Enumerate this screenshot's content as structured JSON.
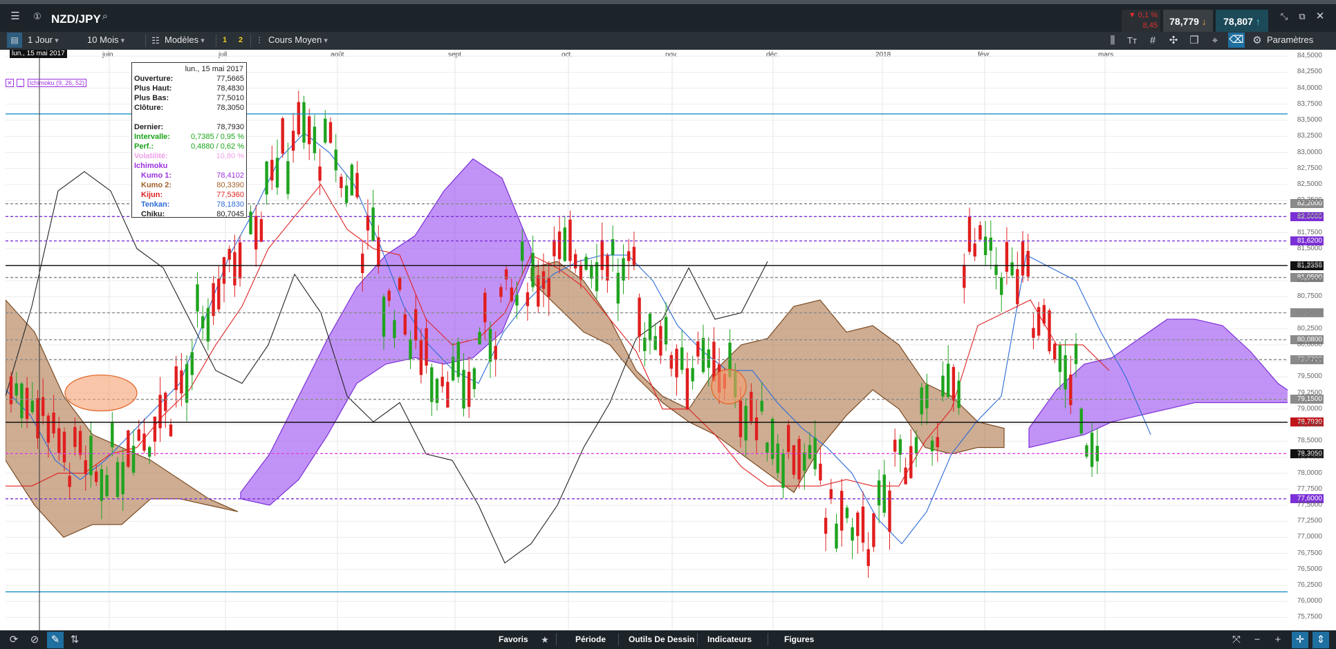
{
  "app": {
    "symbol": "NZD/JPY",
    "change_pct": "▼ 0,1 %",
    "change_abs": "8,45",
    "bid": "78,779",
    "ask": "78,807"
  },
  "toolbar": {
    "interval": "1 Jour",
    "range": "10 Mois",
    "templates": "Modèles",
    "preset1": "1",
    "preset2": "2",
    "price_type": "Cours Moyen",
    "settings": "Paramètres"
  },
  "indicator_label": "Ichimoku (9, 26, 52)",
  "cursor_date": "lun., 15 mai 2017",
  "tooltip": {
    "date": "lun., 15 mai 2017",
    "rows": [
      {
        "label": "Ouverture:",
        "value": "77,5665",
        "color": "#222222"
      },
      {
        "label": "Plus Haut:",
        "value": "78,4830",
        "color": "#222222"
      },
      {
        "label": "Plus Bas:",
        "value": "77,5010",
        "color": "#222222"
      },
      {
        "label": "Clôture:",
        "value": "78,3050",
        "color": "#222222"
      },
      {
        "label": "",
        "value": "",
        "color": "#222222"
      },
      {
        "label": "Dernier:",
        "value": "78,7930",
        "color": "#222222"
      },
      {
        "label": "Intervalle:",
        "value": "0,7385 / 0,95 %",
        "color": "#1aa31a"
      },
      {
        "label": "Perf.:",
        "value": "0,4880 / 0,62 %",
        "color": "#1aa31a"
      },
      {
        "label": "Volatilité:",
        "value": "10,80 %",
        "color": "#f0a0e8"
      },
      {
        "label": "Ichimoku",
        "value": "",
        "color": "#9b30e0"
      },
      {
        "label": "Kumo 1:",
        "value": "78,4102",
        "color": "#9b30e0"
      },
      {
        "label": "Kumo 2:",
        "value": "80,3390",
        "color": "#a0602a"
      },
      {
        "label": "Kijun:",
        "value": "77,5360",
        "color": "#e02020"
      },
      {
        "label": "Tenkan:",
        "value": "78,1830",
        "color": "#2a6ad8"
      },
      {
        "label": "Chiku:",
        "value": "80,7045",
        "color": "#222222"
      }
    ]
  },
  "bottom": {
    "favoris": "Favoris",
    "periode": "Période",
    "outils": "Outils De Dessin",
    "indicateurs": "Indicateurs",
    "figures": "Figures"
  },
  "price_badges": [
    {
      "value": "82,0000",
      "y": 82.0,
      "bg": "#7b2fd6",
      "fg": "#ffffff"
    },
    {
      "value": "82,2000",
      "y": 82.2,
      "bg": "#8a8a8a",
      "fg": "#ffffff"
    },
    {
      "value": "81,6200",
      "y": 81.62,
      "bg": "#7b2fd6",
      "fg": "#ffffff"
    },
    {
      "value": "81,2356",
      "y": 81.2356,
      "bg": "#111111",
      "fg": "#ffffff"
    },
    {
      "value": "81,0500",
      "y": 81.05,
      "bg": "#8a8a8a",
      "fg": "#ffffff"
    },
    {
      "value": "80,5000",
      "y": 80.5,
      "bg": "#8a8a8a",
      "fg": "#ffffff"
    },
    {
      "value": "80,0800",
      "y": 80.08,
      "bg": "#8a8a8a",
      "fg": "#ffffff"
    },
    {
      "value": "79,7700",
      "y": 79.77,
      "bg": "#8a8a8a",
      "fg": "#ffffff"
    },
    {
      "value": "79,1500",
      "y": 79.15,
      "bg": "#8a8a8a",
      "fg": "#ffffff"
    },
    {
      "value": "78,7930",
      "y": 78.793,
      "bg": "#c0151b",
      "fg": "#ffffff"
    },
    {
      "value": "78,3050",
      "y": 78.305,
      "bg": "#111111",
      "fg": "#ffffff"
    },
    {
      "value": "77,6000",
      "y": 77.6,
      "bg": "#7b2fd6",
      "fg": "#ffffff"
    }
  ],
  "chart_data": {
    "type": "line",
    "title": "NZD/JPY",
    "ylim": [
      75.55,
      84.6
    ],
    "y_ticks": [
      "84,5000",
      "84,2500",
      "84,0000",
      "83,7500",
      "83,5000",
      "83,2500",
      "83,0000",
      "82,7500",
      "82,5000",
      "82,2500",
      "82,0000",
      "81,7500",
      "81,5000",
      "81,2500",
      "81,0000",
      "80,7500",
      "80,5000",
      "80,2500",
      "80,0000",
      "79,7500",
      "79,5000",
      "79,2500",
      "79,0000",
      "78,7500",
      "78,5000",
      "78,2500",
      "78,0000",
      "77,7500",
      "77,5000",
      "77,2500",
      "77,0000",
      "76,7500",
      "76,5000",
      "76,2500",
      "76,0000",
      "75,7500"
    ],
    "x_ticks": [
      "juin",
      "juil.",
      "août",
      "sept.",
      "oct.",
      "nov.",
      "déc.",
      "2018",
      "févr.",
      "mars"
    ],
    "horizontal_levels": [
      {
        "y": 83.6,
        "color": "#1a8fc9",
        "style": "solid"
      },
      {
        "y": 82.0,
        "color": "#7b2fd6",
        "style": "dashed"
      },
      {
        "y": 82.2,
        "color": "#8a8a8a",
        "style": "dashed"
      },
      {
        "y": 81.62,
        "color": "#7b2fd6",
        "style": "dashed"
      },
      {
        "y": 81.2356,
        "color": "#111111",
        "style": "solid"
      },
      {
        "y": 81.05,
        "color": "#8a8a8a",
        "style": "dashed"
      },
      {
        "y": 80.5,
        "color": "#8a8a8a",
        "style": "dashed"
      },
      {
        "y": 80.08,
        "color": "#8a8a8a",
        "style": "dashed"
      },
      {
        "y": 79.77,
        "color": "#8a8a8a",
        "style": "dashed"
      },
      {
        "y": 79.15,
        "color": "#8a8a8a",
        "style": "dashed"
      },
      {
        "y": 78.793,
        "color": "#111111",
        "style": "solid"
      },
      {
        "y": 78.305,
        "color": "#e040e0",
        "style": "dashed"
      },
      {
        "y": 77.6,
        "color": "#7b2fd6",
        "style": "dashed"
      },
      {
        "y": 76.15,
        "color": "#1a8fc9",
        "style": "solid"
      }
    ],
    "series": [
      {
        "name": "Tenkan",
        "color": "#2a6ad8",
        "values": [
          79.3,
          78.9,
          78.2,
          77.9,
          78.2,
          78.6,
          79.0,
          79.4,
          80.4,
          81.4,
          82.1,
          82.9,
          83.3,
          83.0,
          82.5,
          81.6,
          80.6,
          80.0,
          79.6,
          79.4,
          80.2,
          80.7,
          81.1,
          81.3,
          81.4,
          81.4,
          81.0,
          80.3,
          79.9,
          79.6,
          79.6,
          79.1,
          78.7,
          78.4,
          78.0,
          77.3,
          76.9,
          77.4,
          78.3,
          78.8,
          79.2,
          81.4,
          81.2,
          81.0,
          80.2,
          79.5,
          78.6
        ]
      },
      {
        "name": "Kijun",
        "color": "#e02020",
        "values": [
          77.8,
          77.8,
          78.0,
          78.0,
          78.3,
          78.4,
          78.9,
          79.3,
          80.0,
          80.6,
          81.5,
          82.0,
          82.5,
          81.8,
          81.5,
          81.4,
          80.4,
          80.0,
          80.1,
          80.5,
          81.4,
          81.2,
          80.9,
          80.4,
          79.9,
          79.0,
          79.0,
          78.6,
          78.1,
          77.8,
          77.8,
          77.8,
          77.9,
          77.8,
          77.8,
          78.5,
          79.0,
          80.3,
          80.5,
          80.7,
          80.0,
          80.0,
          79.6
        ]
      },
      {
        "name": "Chiku",
        "color": "#222222",
        "values": [
          79.2,
          80.6,
          82.4,
          82.7,
          82.4,
          81.5,
          81.2,
          80.4,
          79.6,
          79.4,
          80.0,
          81.1,
          80.5,
          79.2,
          78.8,
          79.1,
          78.3,
          78.2,
          77.5,
          76.6,
          76.9,
          77.5,
          78.4,
          79.1,
          80.1,
          80.4,
          81.2,
          80.4,
          80.5,
          81.3
        ]
      },
      {
        "name": "Kumo 1",
        "color": "#9b30e0",
        "values": [
          78.2,
          77.5,
          77.0,
          77.2,
          77.6,
          78.2,
          78.4,
          77.6,
          77.8,
          78.6,
          79.8,
          81.2,
          81.5,
          82.1,
          82.6,
          82.2,
          81.2,
          80.8,
          81.0,
          81.0,
          80.8,
          80.4,
          80.0,
          79.6,
          78.5,
          77.6,
          77.4,
          77.6,
          78.5,
          78.9,
          79.4,
          79.6,
          80.5,
          80.3,
          79.8,
          79.4
        ]
      },
      {
        "name": "Kumo 2",
        "color": "#a0602a",
        "values": [
          80.7,
          80.2,
          79.2,
          78.6,
          78.4,
          78.4,
          77.9,
          77.8,
          77.9,
          78.4,
          79.4,
          79.9,
          80.0,
          80.2,
          80.9,
          80.6,
          80.0,
          79.8,
          80.8,
          81.0,
          80.6,
          80.4,
          80.1,
          79.8,
          79.7,
          79.0,
          78.8,
          78.5,
          78.9,
          79.1,
          79.2
        ]
      }
    ]
  }
}
